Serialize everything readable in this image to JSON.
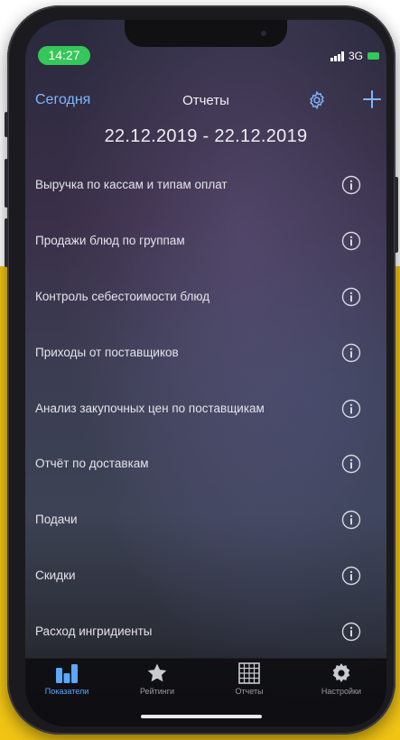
{
  "status_bar": {
    "time": "14:27",
    "network": "3G"
  },
  "nav": {
    "today_label": "Сегодня",
    "title": "Отчеты"
  },
  "date_range": "22.12.2019 - 22.12.2019",
  "reports": [
    {
      "label": "Выручка по кассам и типам оплат"
    },
    {
      "label": "Продажи блюд по группам"
    },
    {
      "label": "Контроль себестоимости блюд"
    },
    {
      "label": "Приходы от поставщиков"
    },
    {
      "label": "Анализ закупочных цен по поставщикам"
    },
    {
      "label": "Отчёт по доставкам"
    },
    {
      "label": "Подачи"
    },
    {
      "label": "Скидки"
    },
    {
      "label": "Расход ингридиенты"
    }
  ],
  "tabs": [
    {
      "label": "Показатели",
      "icon": "chart-bars-icon",
      "active": true
    },
    {
      "label": "Рейтинги",
      "icon": "star-icon",
      "active": false
    },
    {
      "label": "Отчеты",
      "icon": "grid-icon",
      "active": false
    },
    {
      "label": "Настройки",
      "icon": "gear-icon",
      "active": false
    }
  ],
  "colors": {
    "accent": "#7fb6ff",
    "active_tab": "#5aa8ff",
    "status_pill": "#35c759",
    "background_band": "#f1c414"
  }
}
